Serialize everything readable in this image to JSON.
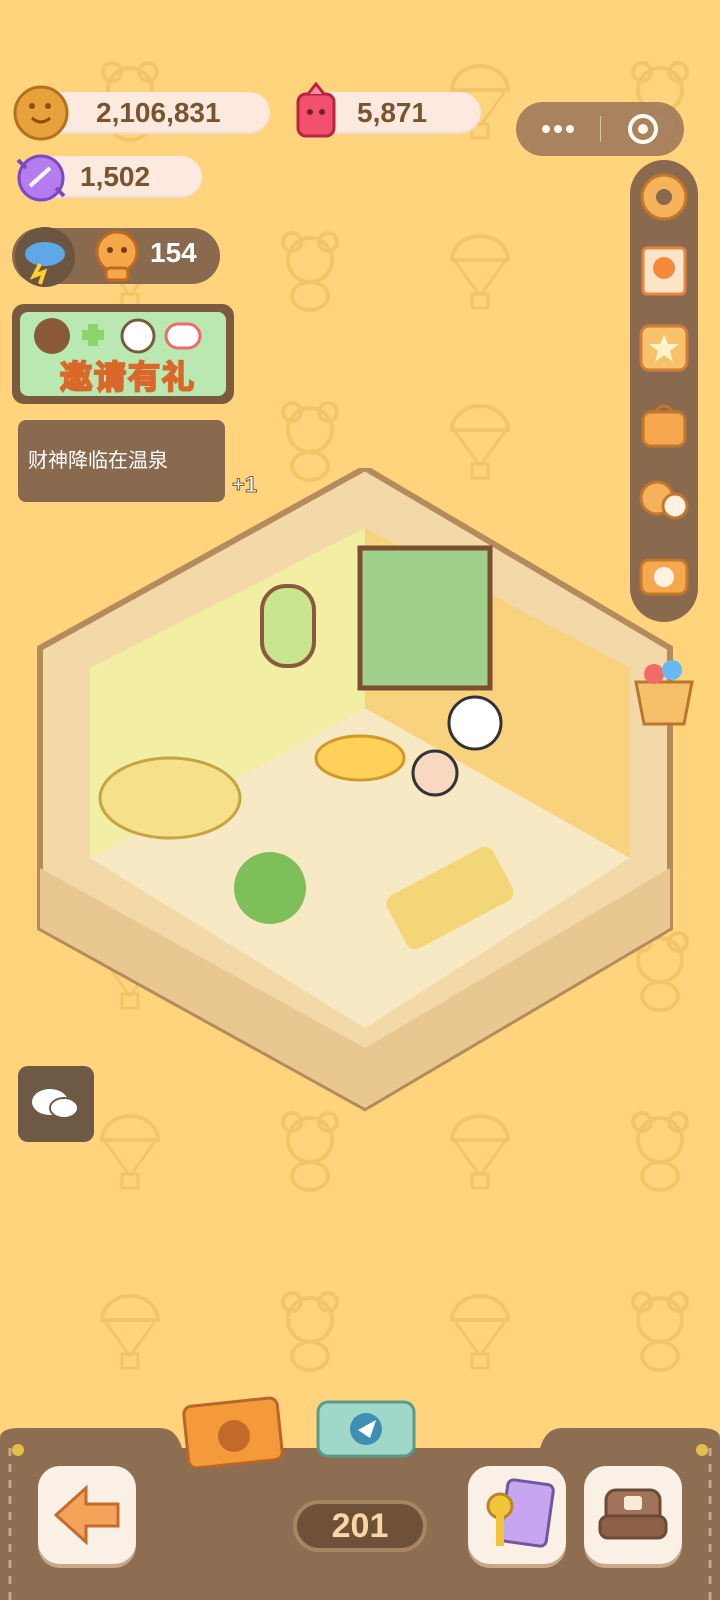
{
  "currencies": {
    "coins": "2,106,831",
    "gems": "5,871",
    "candies": "1,502",
    "weather_points": "154"
  },
  "invite_banner": {
    "label": "邀请有礼"
  },
  "notice": {
    "text": "财神降临在温泉",
    "bonus": "+1"
  },
  "level": {
    "value": "201"
  },
  "icons": {
    "coin": "cookie-coin-icon",
    "gem": "red-gem-icon",
    "candy": "purple-candy-icon",
    "weather": "storm-cloud-icon",
    "settings": "gear-icon",
    "stamp": "stamp-card-icon",
    "star": "star-shop-icon",
    "bag": "backpack-icon",
    "friends": "friends-icon",
    "camera": "camera-icon",
    "chat": "chat-icon",
    "back": "back-arrow-icon",
    "keys": "keys-card-icon",
    "furniture": "sofa-icon"
  },
  "colors": {
    "background": "#ffd47c",
    "toolbar": "#8a6a4f",
    "pill": "#fde9de",
    "text_brown": "#7a5430"
  }
}
